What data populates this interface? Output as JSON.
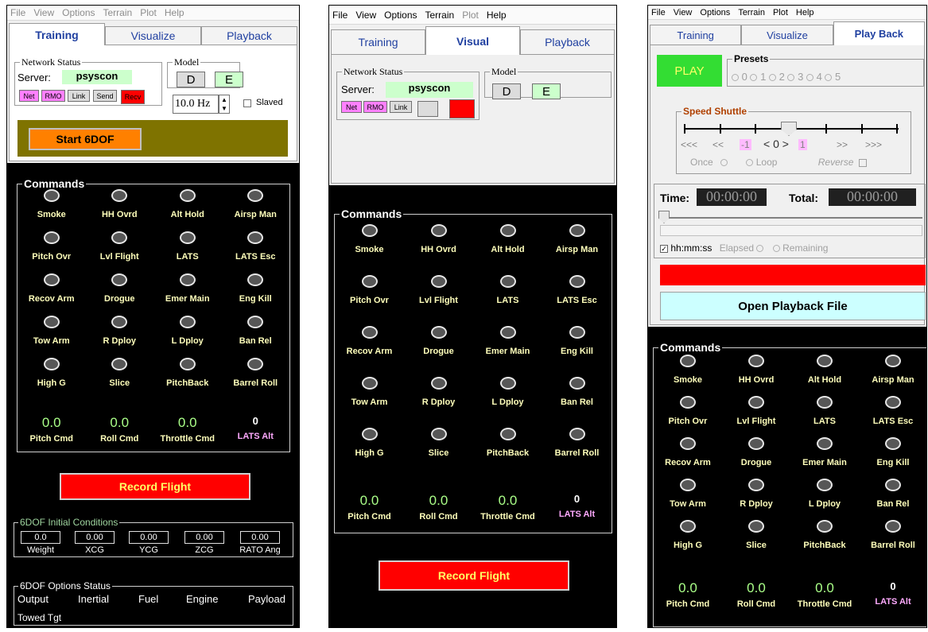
{
  "panels": [
    {
      "menu": [
        "File",
        "View",
        "Options",
        "Terrain",
        "Plot",
        "Help"
      ],
      "tabs": [
        "Training",
        "Visualize",
        "Playback"
      ],
      "network": {
        "title": "Network Status",
        "server_label": "Server:",
        "server_value": "psyscon",
        "chips": [
          "Net",
          "RMO",
          "Link",
          "Send",
          "Recv"
        ]
      },
      "model": {
        "title": "Model",
        "d": "D",
        "e": "E"
      },
      "rate": "10.0 Hz",
      "slaved": "Slaved",
      "start_button": "Start 6DOF",
      "record_button": "Record Flight",
      "initial_conditions": {
        "title": "6DOF Initial Conditions",
        "fields": [
          {
            "label": "Weight",
            "value": "0.0"
          },
          {
            "label": "XCG",
            "value": "0.00"
          },
          {
            "label": "YCG",
            "value": "0.00"
          },
          {
            "label": "ZCG",
            "value": "0.00"
          },
          {
            "label": "RATO Ang",
            "value": "0.00"
          }
        ]
      },
      "options_status": {
        "title": "6DOF Options Status",
        "items": [
          "Output",
          "Inertial",
          "Fuel",
          "Engine",
          "Payload",
          "Towed Tgt"
        ]
      }
    },
    {
      "menu": [
        "File",
        "View",
        "Options",
        "Terrain",
        "Plot",
        "Help"
      ],
      "tabs": [
        "Training",
        "Visual",
        "Playback"
      ],
      "network": {
        "title": "Network Status",
        "server_label": "Server:",
        "server_value": "psyscon",
        "chips": [
          "Net",
          "RMO",
          "Link"
        ]
      },
      "model": {
        "title": "Model",
        "d": "D",
        "e": "E"
      },
      "record_button": "Record Flight"
    },
    {
      "menu": [
        "File",
        "View",
        "Options",
        "Terrain",
        "Plot",
        "Help"
      ],
      "tabs": [
        "Training",
        "Visualize",
        "Play Back"
      ],
      "play_button": "PLAY",
      "presets": {
        "title": "Presets",
        "options": [
          "0",
          "1",
          "2",
          "3",
          "4",
          "5"
        ]
      },
      "shuttle": {
        "title": "Speed Shuttle",
        "marks": [
          "<<<",
          "<<",
          "-1",
          "< 0 >",
          "1",
          ">>",
          ">>>"
        ],
        "once": "Once",
        "loop": "Loop",
        "reverse": "Reverse"
      },
      "time": {
        "label": "Time:",
        "value": "00:00:00",
        "total_label": "Total:",
        "total_value": "00:00:00",
        "format": "hh:mm:ss",
        "elapsed": "Elapsed",
        "remaining": "Remaining"
      },
      "open_button": "Open Playback File"
    }
  ],
  "commands": {
    "title": "Commands",
    "buttons": [
      "Smoke",
      "HH Ovrd",
      "Alt Hold",
      "Airsp Man",
      "Pitch Ovr",
      "Lvl Flight",
      "LATS",
      "LATS Esc",
      "Recov Arm",
      "Drogue",
      "Emer Main",
      "Eng Kill",
      "Tow Arm",
      "R Dploy",
      "L Dploy",
      "Ban Rel",
      "High G",
      "Slice",
      "PitchBack",
      "Barrel Roll"
    ],
    "values": [
      {
        "label": "Pitch Cmd",
        "value": "0.0"
      },
      {
        "label": "Roll Cmd",
        "value": "0.0"
      },
      {
        "label": "Throttle Cmd",
        "value": "0.0"
      },
      {
        "label": "LATS Alt",
        "value": "0"
      }
    ]
  },
  "colors": {
    "command_label": "#ffffbb",
    "value_green": "#aaff88",
    "record_red": "#ff0000",
    "start_orange": "#ff8000",
    "play_green": "#33dd33",
    "open_cyan": "#ccffff"
  }
}
